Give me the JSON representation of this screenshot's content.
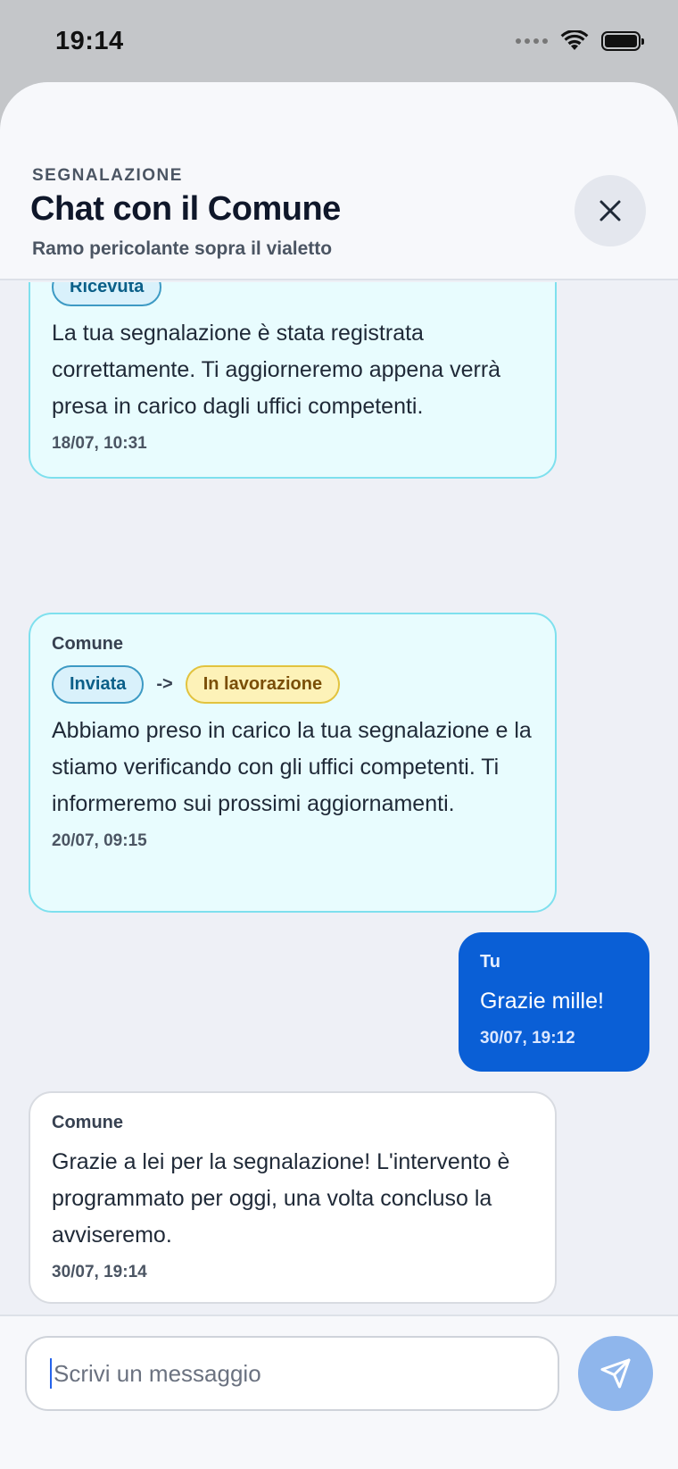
{
  "status_bar": {
    "time": "19:14"
  },
  "header": {
    "eyebrow": "SEGNALAZIONE",
    "title": "Chat con il Comune",
    "subtitle": "Ramo pericolante sopra il vialetto"
  },
  "messages": [
    {
      "status_pill": "Ricevuta",
      "text": "La tua segnalazione è stata registrata correttamente. Ti aggiorneremo appena verrà presa in carico dagli uffici competenti.",
      "time": "18/07, 10:31"
    },
    {
      "sender": "Comune",
      "status_from": "Inviata",
      "arrow": "->",
      "status_to": "In lavorazione",
      "text": "Abbiamo preso in carico la tua segnalazione e la stiamo verificando con gli uffici competenti. Ti informeremo sui prossimi aggiornamenti.",
      "time": "20/07, 09:15"
    },
    {
      "sender": "Tu",
      "text": "Grazie mille!",
      "time": "30/07, 19:12"
    },
    {
      "sender": "Comune",
      "text": "Grazie a lei per la segnalazione! L'intervento è programmato per oggi, una volta concluso la avviseremo.",
      "time": "30/07, 19:14"
    }
  ],
  "composer": {
    "placeholder": "Scrivi un messaggio"
  },
  "icons": {
    "close": "close-icon",
    "send": "send-icon",
    "wifi": "wifi-icon",
    "battery": "battery-icon"
  },
  "colors": {
    "accent": "#0a5fd6",
    "status_bubble_bg": "#e8fcfe",
    "status_bubble_border": "#7ee0ee"
  }
}
